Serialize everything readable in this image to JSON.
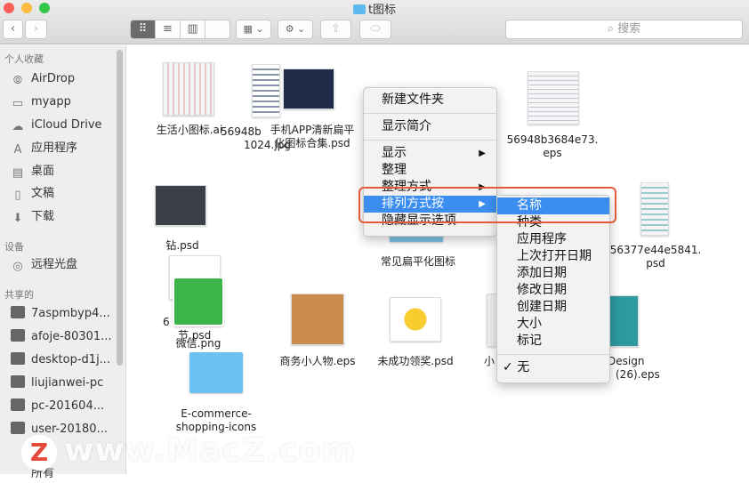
{
  "window": {
    "title": "t图标"
  },
  "toolbar": {
    "back": "‹",
    "forward": "›",
    "view_icon": "⠿",
    "view_list": "≡",
    "view_columns": "▥",
    "view_coverflow": "▯",
    "arrange": "▦ ⌄",
    "action": "⚙ ⌄",
    "share": "⇧",
    "tag": "⬭",
    "search_placeholder": "搜索",
    "search_icon": "⌕"
  },
  "sidebar": {
    "favorites_header": "个人收藏",
    "favorites": [
      {
        "label": "AirDrop",
        "icon": "⦾"
      },
      {
        "label": "myapp",
        "icon": "▭"
      },
      {
        "label": "iCloud Drive",
        "icon": "☁"
      },
      {
        "label": "应用程序",
        "icon": "A"
      },
      {
        "label": "桌面",
        "icon": "▤"
      },
      {
        "label": "文稿",
        "icon": "▯"
      },
      {
        "label": "下载",
        "icon": "⬇"
      }
    ],
    "devices_header": "设备",
    "devices": [
      {
        "label": "远程光盘",
        "icon": "◎"
      }
    ],
    "shared_header": "共享的",
    "shared": [
      {
        "label": "7aspmbyp4..."
      },
      {
        "label": "afoje-80301..."
      },
      {
        "label": "desktop-d1j..."
      },
      {
        "label": "liujianwei-pc"
      },
      {
        "label": "pc-201604..."
      },
      {
        "label": "user-20180..."
      }
    ],
    "partial": "所有"
  },
  "files": [
    {
      "name": "生活小图标.ai"
    },
    {
      "name": "56948b",
      "name2": "1024.jpg"
    },
    {
      "name": "手机APP清新扁平",
      "name2": "化图标合集.psd"
    },
    {
      "name": "56948b3684e73.",
      "name2": "eps"
    },
    {
      "name": "钻.psd"
    },
    {
      "name": "常见扁平化图标"
    },
    {
      "name": "56377e44e5841.",
      "name2": "psd"
    },
    {
      "name": "6",
      "name2": "节.psd"
    },
    {
      "name": "微信.png"
    },
    {
      "name": "商务小人物.eps"
    },
    {
      "name": "未成功领奖.psd"
    },
    {
      "name": "小"
    },
    {
      "name": "Design",
      "name2": "(26).eps"
    },
    {
      "name": "E-commerce-",
      "name2": "shopping-icons"
    }
  ],
  "context_menu": {
    "items": [
      "新建文件夹",
      "显示简介",
      "显示",
      "整理",
      "整理方式",
      "排列方式按",
      "隐藏显示选项"
    ],
    "submenu_arrow": "▶"
  },
  "sort_submenu": {
    "items": [
      "名称",
      "种类",
      "应用程序",
      "上次打开日期",
      "添加日期",
      "修改日期",
      "创建日期",
      "大小",
      "标记"
    ],
    "none": "无",
    "check": "✓",
    "selected": "名称"
  },
  "watermark": {
    "logo": "Z",
    "text": "www.MacZ.com"
  },
  "colors": {
    "highlight": "#3b8ef0",
    "callout": "#e35a3a",
    "folder": "#5fb8ee"
  }
}
